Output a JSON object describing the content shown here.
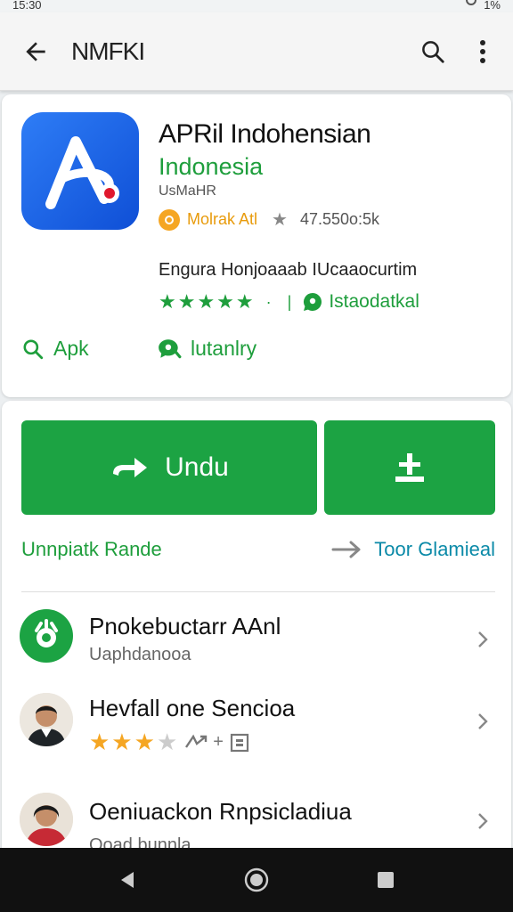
{
  "status_bar": {
    "time": "15:30",
    "battery": "1%"
  },
  "app_bar": {
    "title": "NMFKI"
  },
  "app": {
    "name": "APRil Indohensian",
    "developer": "Indonesia",
    "small_label": "UsMaHR",
    "badge_label": "Molrak Atl",
    "rating_text": "47.550o:5k",
    "description": "Engura Honjoaaab IUcaaocurtim",
    "green_tag": "Istaodatkal",
    "links": [
      {
        "label": "Apk",
        "icon": "search-icon"
      },
      {
        "label": "lutanlry",
        "icon": "chat-icon"
      }
    ]
  },
  "actions": {
    "download_label": "Undu",
    "sub_left": "Unnpiatk Rande",
    "sub_right": "Toor Glamieal"
  },
  "list": [
    {
      "title": "Pnokebuctarr AAnl",
      "subtitle": "Uaphdanooa",
      "avatar": "app-logo-icon"
    },
    {
      "title": "Hevfall one Sencioa",
      "subtitle": "",
      "rating_stars": 3,
      "avatar": "person-avatar"
    },
    {
      "title": "Oeniuackon Rnpsicladiua",
      "subtitle": "Ooad bunnla",
      "avatar": "person-avatar"
    }
  ],
  "colors": {
    "accent_green": "#1ca343",
    "link_teal": "#0b8aa8",
    "icon_blue": "#1a5fe8",
    "star_orange": "#f5a623"
  }
}
